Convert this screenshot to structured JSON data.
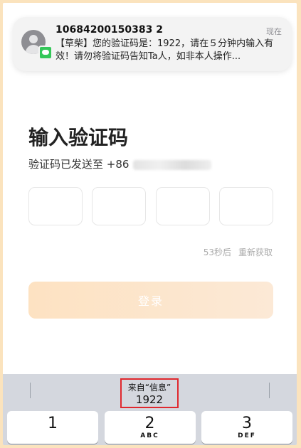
{
  "notification": {
    "sender": "10684200150383 2",
    "time": "现在",
    "body": "【草柴】您的验证码是：1922，请在５分钟内输入有效！请勿将验证码告知Ta人，如非本人操作..."
  },
  "page": {
    "title": "输入验证码",
    "subtitle": "验证码已发送至 +86",
    "countdown": "53秒后",
    "resend": "重新获取",
    "login_label": "登录"
  },
  "keyboard": {
    "suggestion_source": "来自“信息”",
    "suggestion_code": "1922",
    "keys": [
      {
        "num": "1",
        "letters": ""
      },
      {
        "num": "2",
        "letters": "ABC"
      },
      {
        "num": "3",
        "letters": "DEF"
      }
    ]
  }
}
